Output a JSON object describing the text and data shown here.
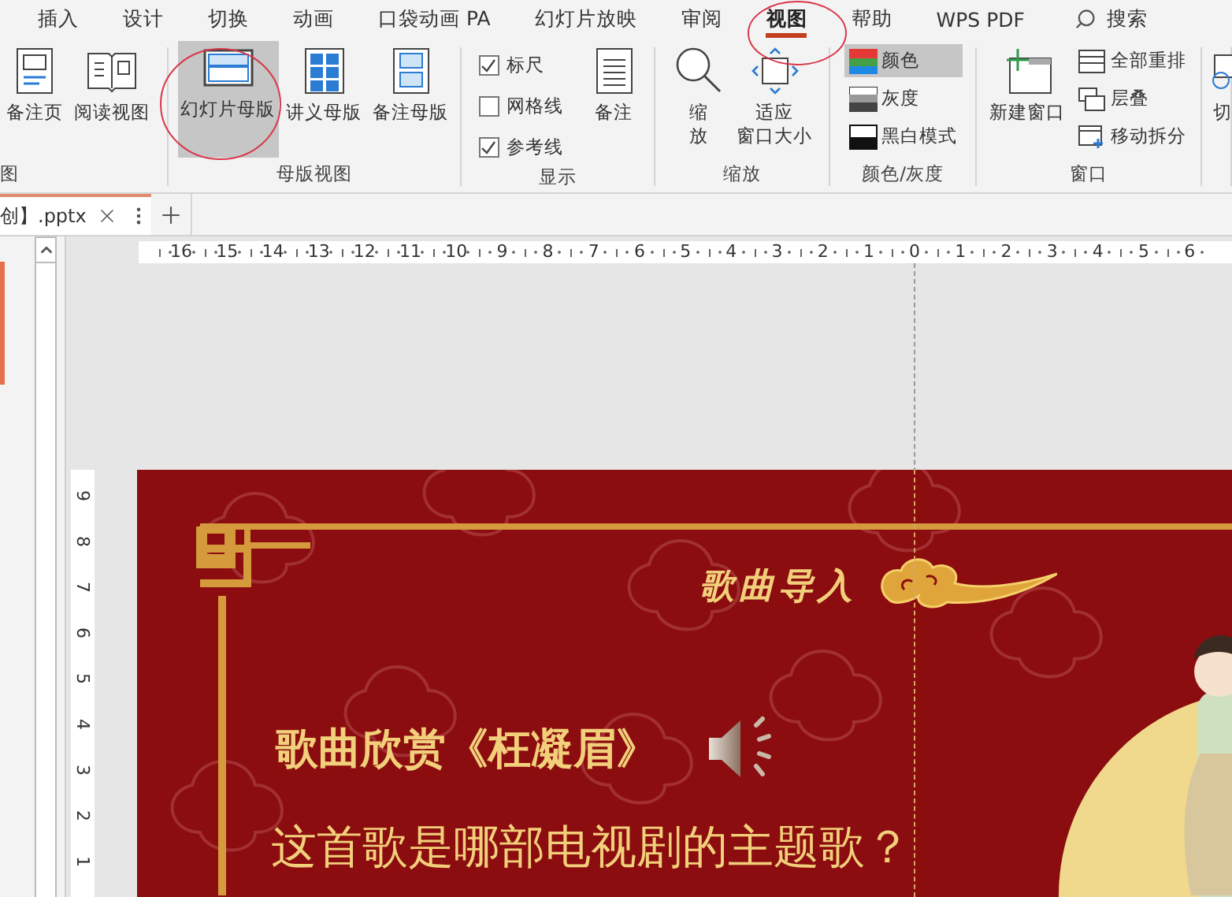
{
  "ribbon_tabs": [
    {
      "label": "插入",
      "selected": false
    },
    {
      "label": "设计",
      "selected": false
    },
    {
      "label": "切换",
      "selected": false
    },
    {
      "label": "动画",
      "selected": false
    },
    {
      "label": "口袋动画 PA",
      "selected": false
    },
    {
      "label": "幻灯片放映",
      "selected": false
    },
    {
      "label": "审阅",
      "selected": false
    },
    {
      "label": "视图",
      "selected": true
    },
    {
      "label": "帮助",
      "selected": false
    },
    {
      "label": "WPS PDF",
      "selected": false
    }
  ],
  "search": {
    "label": "搜索"
  },
  "ribbon_groups": [
    {
      "label": "图",
      "buttons": [
        {
          "lines": [
            "备注页"
          ],
          "selected": false
        },
        {
          "lines": [
            "阅读视图"
          ],
          "selected": false
        }
      ]
    },
    {
      "label": "母版视图",
      "buttons": [
        {
          "lines": [
            "幻灯片母版"
          ],
          "selected": true
        },
        {
          "lines": [
            "讲义母版"
          ],
          "selected": false
        },
        {
          "lines": [
            "备注母版"
          ],
          "selected": false
        }
      ]
    },
    {
      "label": "显示",
      "checkboxes": [
        {
          "label": "标尺",
          "checked": true
        },
        {
          "label": "网格线",
          "checked": false
        },
        {
          "label": "参考线",
          "checked": true
        }
      ],
      "buttons": [
        {
          "lines": [
            "备注"
          ],
          "selected": false
        }
      ]
    },
    {
      "label": "缩放",
      "buttons": [
        {
          "lines": [
            "缩",
            "放"
          ],
          "selected": false
        },
        {
          "lines": [
            "适应",
            "窗口大小"
          ],
          "selected": false
        }
      ]
    },
    {
      "label": "颜色/灰度",
      "small_buttons": [
        {
          "label": "颜色",
          "selected": true
        },
        {
          "label": "灰度",
          "selected": false
        },
        {
          "label": "黑白模式",
          "selected": false
        }
      ]
    },
    {
      "label": "窗口",
      "buttons": [
        {
          "lines": [
            "新建窗口"
          ],
          "selected": false
        }
      ],
      "small_buttons": [
        {
          "label": "全部重排",
          "selected": false
        },
        {
          "label": "层叠",
          "selected": false
        },
        {
          "label": "移动拆分",
          "selected": false
        }
      ]
    },
    {
      "buttons": [
        {
          "lines": [
            "切"
          ],
          "selected": false
        }
      ]
    }
  ],
  "document_tabs": [
    {
      "label": "创】.pptx",
      "selected": true
    }
  ],
  "horizontal_ruler": [
    "16",
    "15",
    "14",
    "13",
    "12",
    "11",
    "10",
    "9",
    "8",
    "7",
    "6",
    "5",
    "4",
    "3",
    "2",
    "1",
    "0",
    "1",
    "2",
    "3",
    "4",
    "5",
    "6"
  ],
  "vertical_ruler": [
    "9",
    "8",
    "7",
    "6",
    "5",
    "4",
    "3",
    "2",
    "1"
  ],
  "slide": {
    "section_title": "歌曲导入",
    "song_heading": "歌曲欣赏《枉凝眉》",
    "question": "这首歌是哪部电视剧的主题歌？"
  }
}
